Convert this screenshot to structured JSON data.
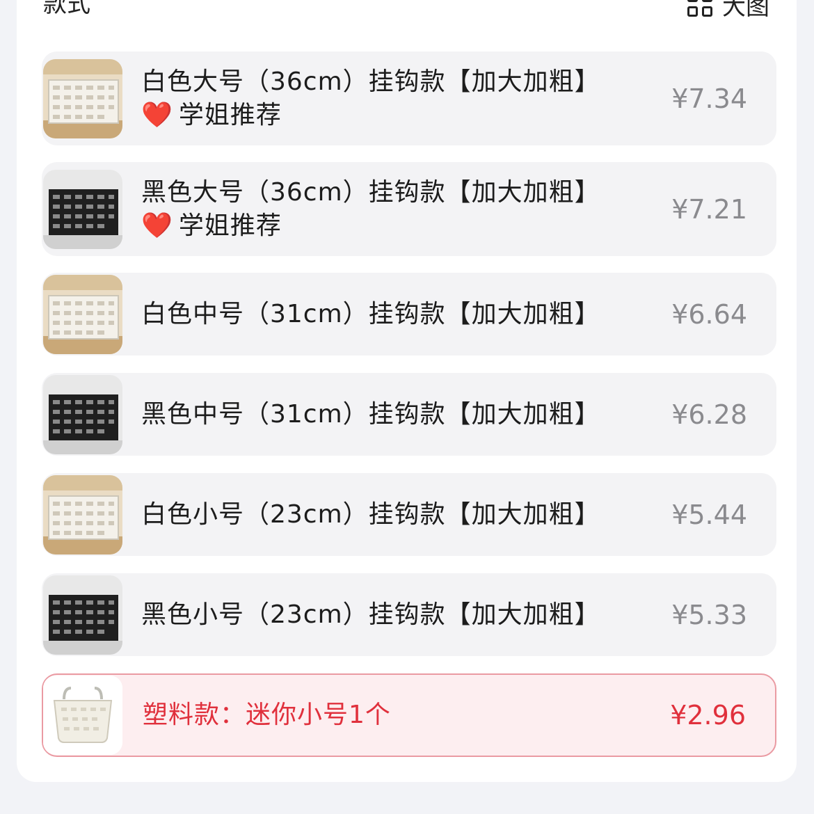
{
  "header": {
    "title": "款式",
    "view_label": "大图",
    "view_icon": "grid-icon"
  },
  "options": [
    {
      "id": "white-large",
      "line1": "白色大号（36cm）挂钩款【加大加粗】",
      "line2": "学姐推荐",
      "line2_icon": "❤️",
      "price": "¥7.34",
      "basket_color": "white",
      "selected": false
    },
    {
      "id": "black-large",
      "line1": "黑色大号（36cm）挂钩款【加大加粗】",
      "line2": "学姐推荐",
      "line2_icon": "❤️",
      "price": "¥7.21",
      "basket_color": "black",
      "selected": false
    },
    {
      "id": "white-medium",
      "line1": "白色中号（31cm）挂钩款【加大加粗】",
      "price": "¥6.64",
      "basket_color": "white",
      "selected": false
    },
    {
      "id": "black-medium",
      "line1": "黑色中号（31cm）挂钩款【加大加粗】",
      "price": "¥6.28",
      "basket_color": "black",
      "selected": false
    },
    {
      "id": "white-small",
      "line1": "白色小号（23cm）挂钩款【加大加粗】",
      "price": "¥5.44",
      "basket_color": "white",
      "selected": false
    },
    {
      "id": "black-small",
      "line1": "黑色小号（23cm）挂钩款【加大加粗】",
      "price": "¥5.33",
      "basket_color": "black",
      "selected": false
    },
    {
      "id": "plastic-mini",
      "line1": "塑料款：迷你小号1个",
      "price": "¥2.96",
      "basket_color": "plastic",
      "selected": true
    }
  ],
  "colors": {
    "selected_text": "#e0303c",
    "selected_border": "#ea9aa2",
    "selected_bg": "#fdeef0",
    "price_text": "#8a8a8e",
    "option_bg": "#f3f3f5"
  }
}
